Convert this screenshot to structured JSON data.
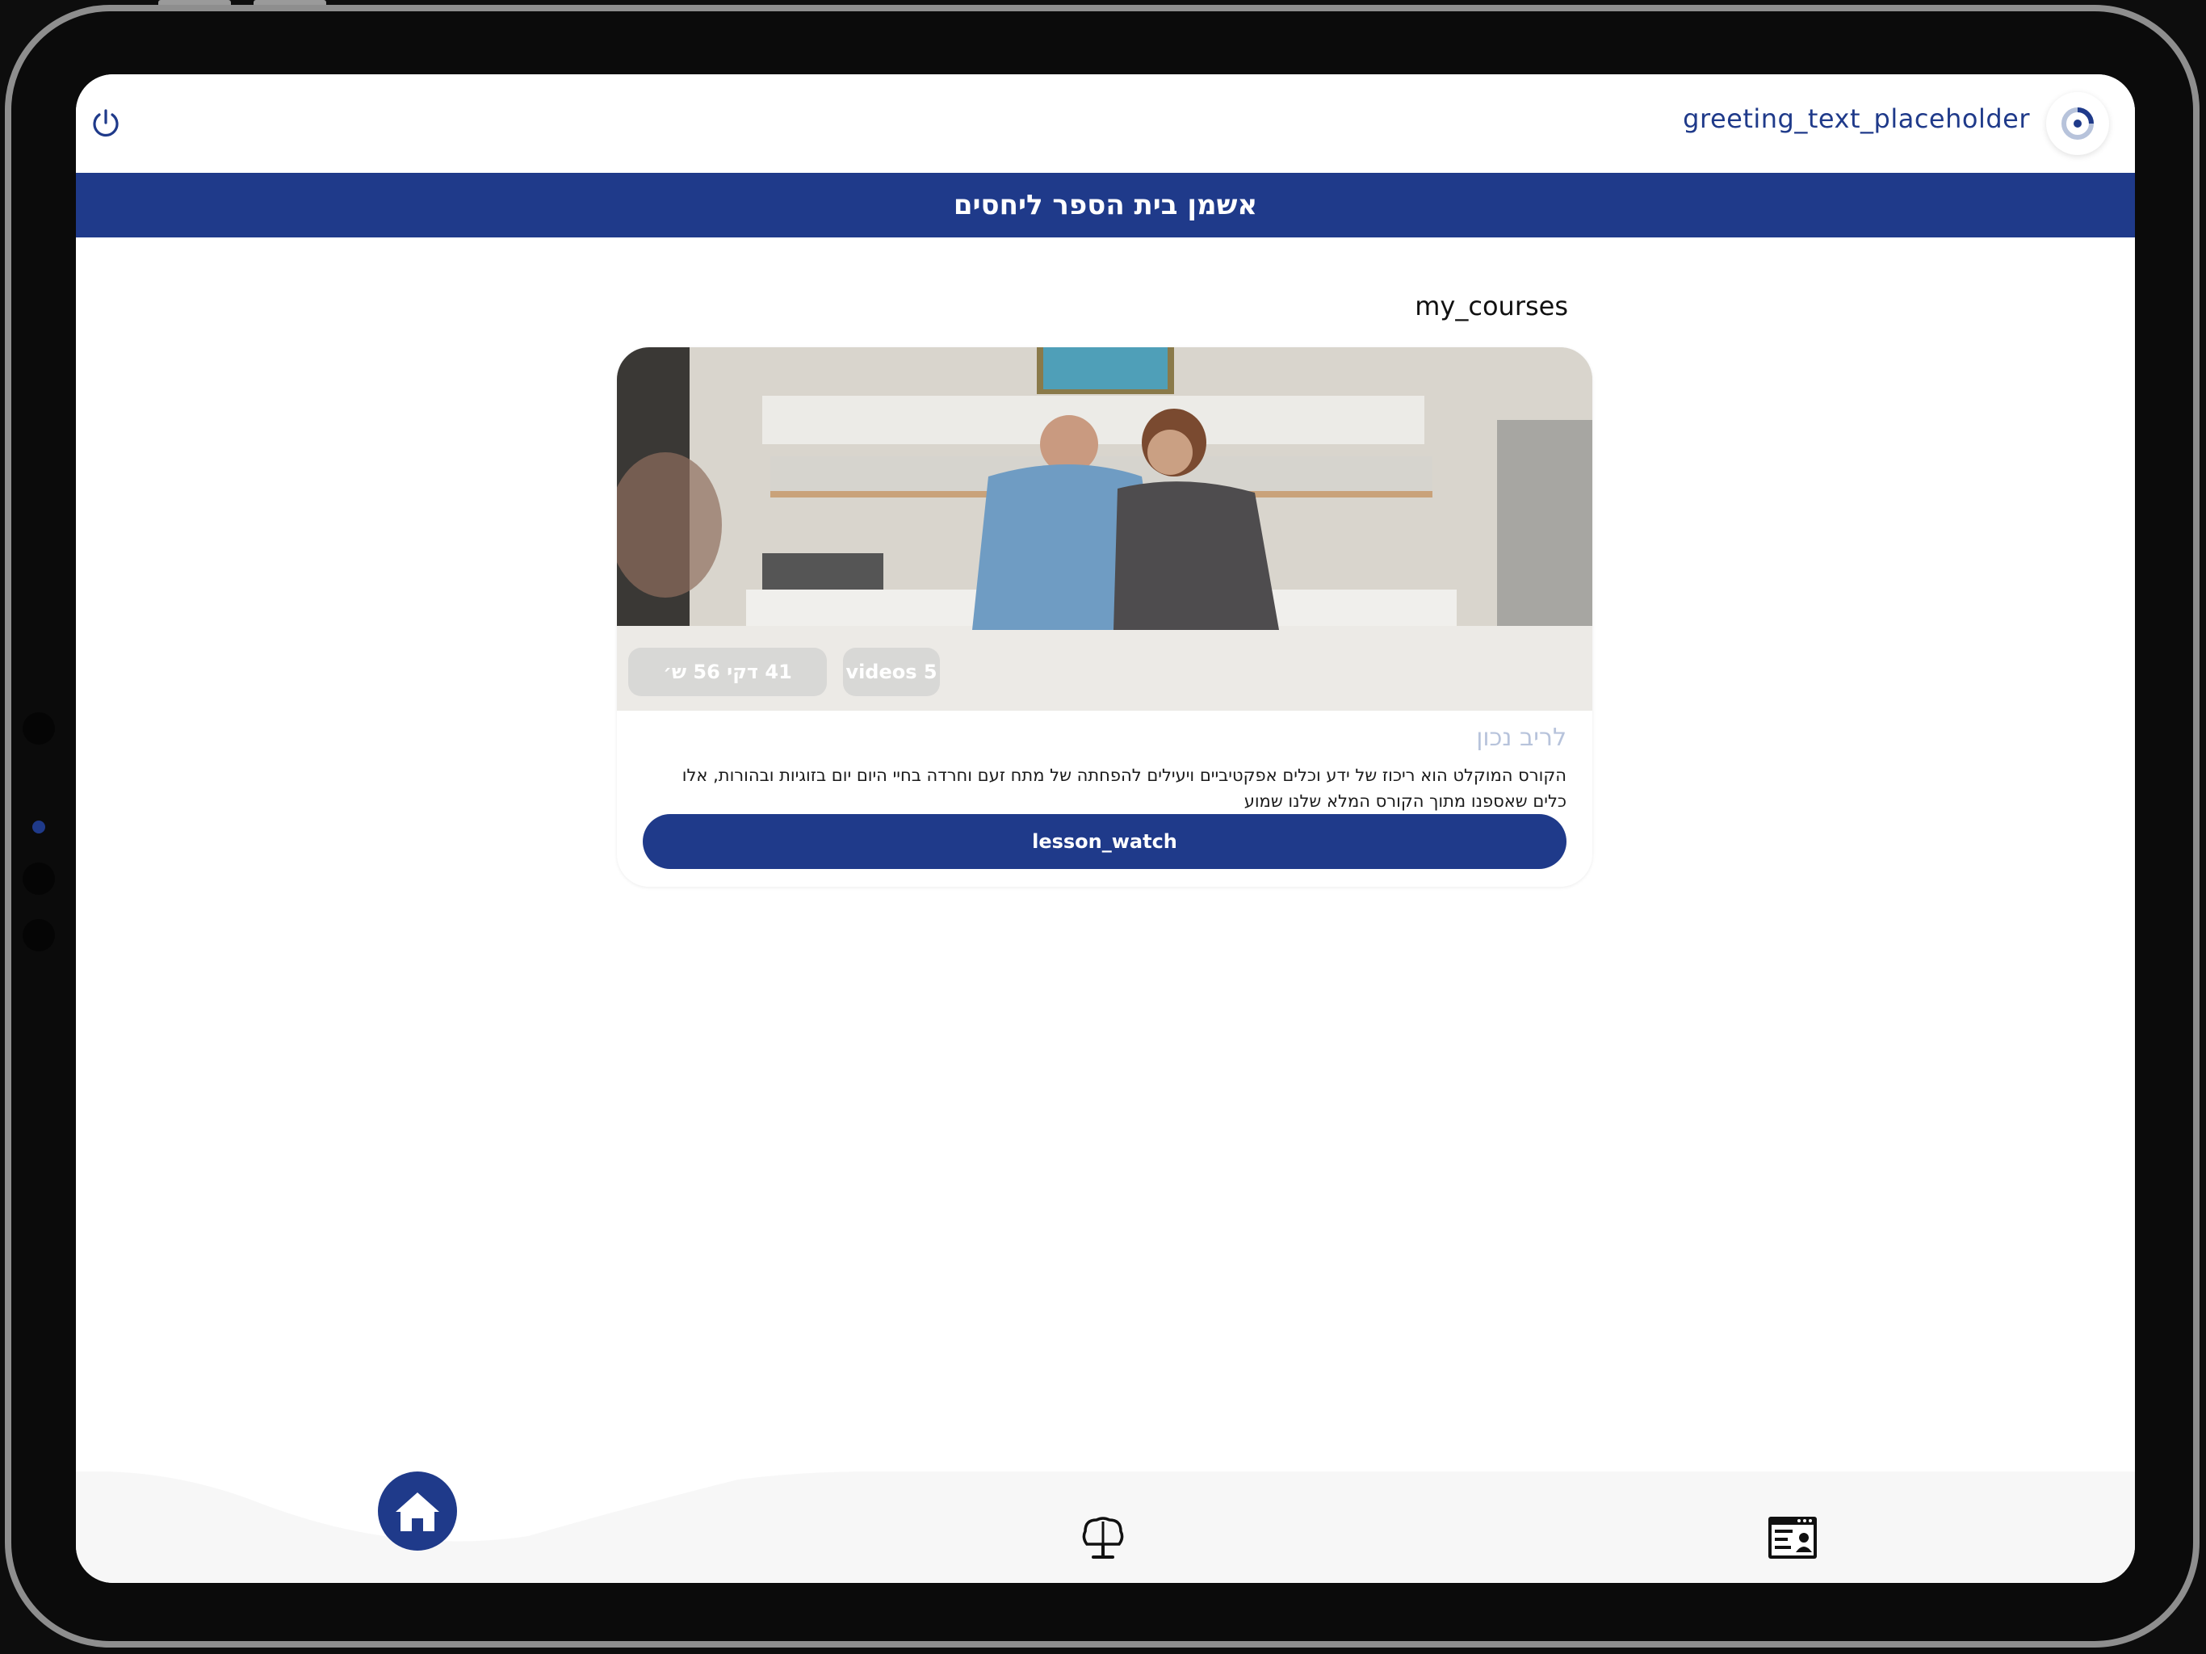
{
  "header": {
    "greeting": "greeting_text_placeholder",
    "power_icon": "power-icon",
    "logo_icon": "app-logo-icon"
  },
  "banner": {
    "title": "אשמן בית הספר ליחסים"
  },
  "main": {
    "section_title": "my_courses",
    "course": {
      "videos_badge": "videos 5",
      "duration_badge": "41 דקי 56 ש׳",
      "title": "לריב נכון",
      "description": "הקורס המוקלט הוא ריכוז של ידע וכלים אפקטיביים ויעילים להפחתה של מתח זעם וחרדה בחיי היום יום בזוגיות ובהורות, אלו כלים שאספנו מתוך הקורס המלא שלנו שמוע",
      "watch_button": "lesson_watch"
    }
  },
  "bottom_nav": {
    "items": [
      {
        "icon": "home-icon",
        "active": true
      },
      {
        "icon": "brain-monitor-icon",
        "active": false
      },
      {
        "icon": "profile-card-icon",
        "active": false
      }
    ]
  },
  "colors": {
    "brand": "#1f3a8a",
    "title_muted": "#b7c3db",
    "nav_bg": "#f7f7f7"
  }
}
